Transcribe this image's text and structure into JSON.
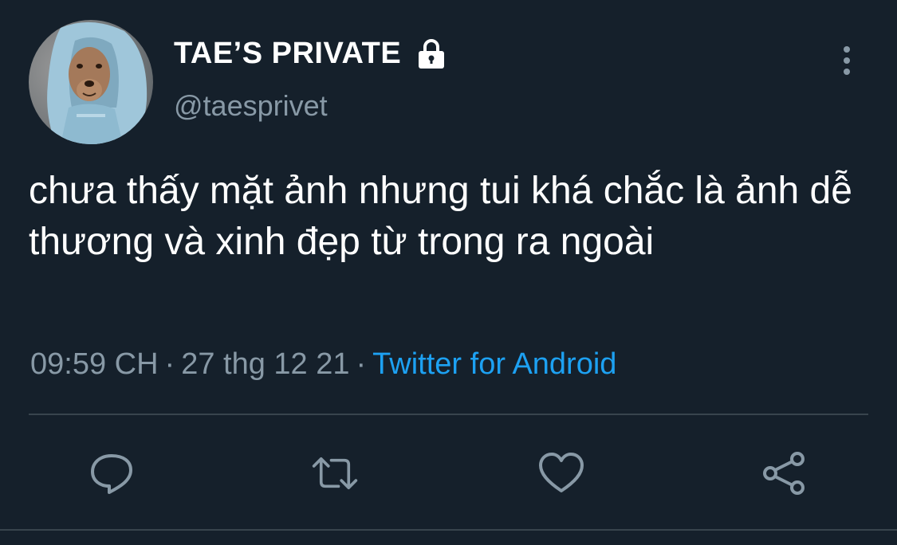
{
  "user": {
    "display_name": "TAE’S PRIVATE",
    "handle": "@taesprivet",
    "avatar_icon": "dog-avatar",
    "protected_icon": "lock-icon"
  },
  "tweet": {
    "text": "chưa thấy mặt ảnh nhưng tui khá chắc là ảnh dễ thương và xinh đẹp từ trong ra ngoài",
    "time": "09:59 CH",
    "date": "27 thg 12 21",
    "separator": "·",
    "source": "Twitter for Android"
  },
  "actions": {
    "reply_icon": "reply-icon",
    "retweet_icon": "retweet-icon",
    "like_icon": "heart-icon",
    "share_icon": "share-icon",
    "more_icon": "more-vertical-icon"
  },
  "colors": {
    "background": "#15202b",
    "text_primary": "#ffffff",
    "text_secondary": "#8899a6",
    "accent": "#1da1f2",
    "divider": "#38444d"
  }
}
